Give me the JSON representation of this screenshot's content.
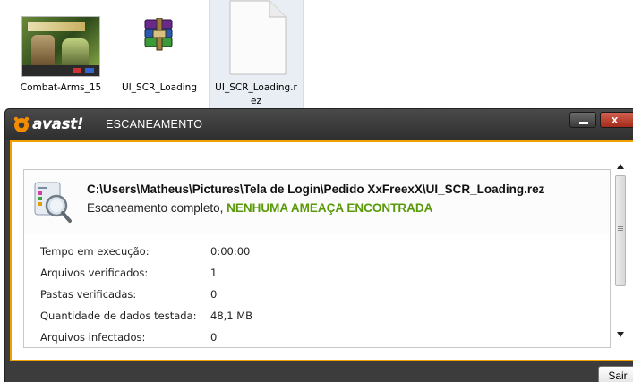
{
  "explorer": {
    "files": [
      {
        "name": "Combat-Arms_15",
        "icon": "image-thumbnail-icon"
      },
      {
        "name": "UI_SCR_Loading",
        "icon": "winrar-archive-icon"
      },
      {
        "name_line1": "UI_SCR_Loading.r",
        "name_line2": "ez",
        "icon": "blank-document-icon",
        "selected": true
      }
    ]
  },
  "window": {
    "brand": "avast!",
    "title": "ESCANEAMENTO",
    "accent_color": "#f0a000",
    "minimize_icon": "minimize-icon",
    "close_label": "x"
  },
  "report": {
    "path": "C:\\Users\\Matheus\\Pictures\\Tela de Login\\Pedido XxFreexX\\UI_SCR_Loading.rez",
    "status_prefix": "Escaneamento completo, ",
    "status_result": "NENHUMA AMEAÇA ENCONTRADA",
    "status_color": "#5a9a0a"
  },
  "stats": [
    {
      "label": "Tempo em execução:",
      "value": "0:00:00"
    },
    {
      "label": "Arquivos verificados:",
      "value": "1"
    },
    {
      "label": "Pastas verificadas:",
      "value": "0"
    },
    {
      "label": "Quantidade de dados testada:",
      "value": "48,1 MB"
    },
    {
      "label": "Arquivos infectados:",
      "value": "0"
    }
  ],
  "footer": {
    "exit_label": "Sair"
  }
}
